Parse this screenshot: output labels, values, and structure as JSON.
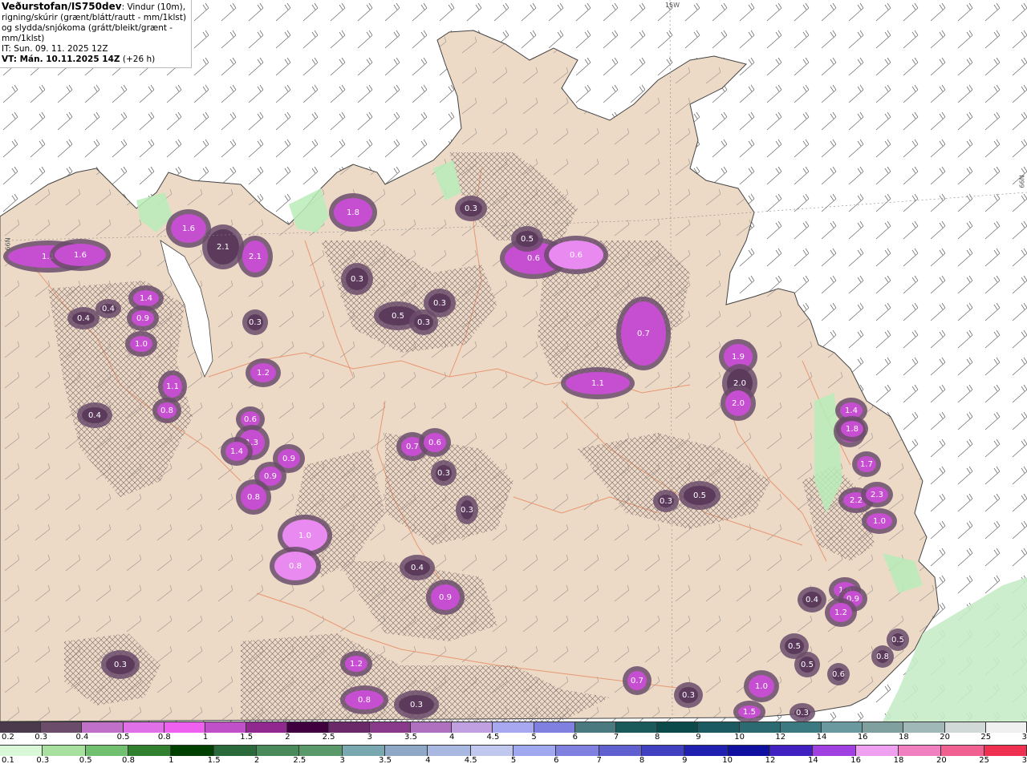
{
  "header": {
    "source": "Veðurstofan/IS750dev",
    "description": ": Vindur (10m), rigning/skúrir (grænt/blátt/rautt - mm/1klst) og slydda/snjókoma (grátt/bleikt/grænt - mm/1klst)",
    "issue_time": "IT: Sun. 09. 11. 2025 12Z",
    "valid_time": "VT: Mán. 10.11.2025 14Z",
    "lead_time": "(+26 h)"
  },
  "grid_labels": {
    "lon": "15W",
    "lat_left": "66N",
    "lat_right": "66N"
  },
  "colors": {
    "land": "#ecd9c6",
    "sea": "#ffffff",
    "road": "#e8906a",
    "snow_outline": "#5b3a5b"
  },
  "snow_cells": [
    {
      "label": "1.1",
      "shade": "mid"
    },
    {
      "label": "1.6",
      "shade": "mid"
    },
    {
      "label": "1.6",
      "shade": "mid"
    },
    {
      "label": "2.1",
      "shade": "dark"
    },
    {
      "label": "2.1",
      "shade": "mid"
    },
    {
      "label": "1.8",
      "shade": "mid"
    },
    {
      "label": "0.3",
      "shade": "dark"
    },
    {
      "label": "0.3",
      "shade": "dark"
    },
    {
      "label": "0.4",
      "shade": "dark"
    },
    {
      "label": "0.6",
      "shade": "mid"
    },
    {
      "label": "0.6",
      "shade": "light"
    },
    {
      "label": "0.5",
      "shade": "dark"
    },
    {
      "label": "0.3",
      "shade": "dark"
    },
    {
      "label": "0.3",
      "shade": "dark"
    },
    {
      "label": "0.5",
      "shade": "dark"
    },
    {
      "label": "0.7",
      "shade": "mid"
    },
    {
      "label": "1.1",
      "shade": "mid"
    },
    {
      "label": "1.9",
      "shade": "mid"
    },
    {
      "label": "2.0",
      "shade": "dark"
    },
    {
      "label": "2.0",
      "shade": "mid"
    },
    {
      "label": "1.4",
      "shade": "mid"
    },
    {
      "label": "0.9",
      "shade": "mid"
    },
    {
      "label": "1.0",
      "shade": "mid"
    },
    {
      "label": "1.1",
      "shade": "mid"
    },
    {
      "label": "0.8",
      "shade": "mid"
    },
    {
      "label": "0.4",
      "shade": "dark"
    },
    {
      "label": "0.4",
      "shade": "dark"
    },
    {
      "label": "1.2",
      "shade": "mid"
    },
    {
      "label": "0.6",
      "shade": "mid"
    },
    {
      "label": "1.3",
      "shade": "mid"
    },
    {
      "label": "1.4",
      "shade": "mid"
    },
    {
      "label": "0.9",
      "shade": "mid"
    },
    {
      "label": "0.9",
      "shade": "mid"
    },
    {
      "label": "0.8",
      "shade": "mid"
    },
    {
      "label": "1.0",
      "shade": "light"
    },
    {
      "label": "0.8",
      "shade": "light"
    },
    {
      "label": "0.7",
      "shade": "mid"
    },
    {
      "label": "0.6",
      "shade": "mid"
    },
    {
      "label": "0.3",
      "shade": "dark"
    },
    {
      "label": "0.3",
      "shade": "dark"
    },
    {
      "label": "0.4",
      "shade": "dark"
    },
    {
      "label": "0.9",
      "shade": "mid"
    },
    {
      "label": "0.3",
      "shade": "dark"
    },
    {
      "label": "1.2",
      "shade": "mid"
    },
    {
      "label": "0.8",
      "shade": "mid"
    },
    {
      "label": "0.3",
      "shade": "dark"
    },
    {
      "label": "0.7",
      "shade": "mid"
    },
    {
      "label": "0.3",
      "shade": "dark"
    },
    {
      "label": "1.0",
      "shade": "mid"
    },
    {
      "label": "1.2",
      "shade": "mid"
    },
    {
      "label": "0.3",
      "shade": "dark"
    },
    {
      "label": "0.5",
      "shade": "dark"
    },
    {
      "label": "1.4",
      "shade": "mid"
    },
    {
      "label": "1.8",
      "shade": "mid"
    },
    {
      "label": "1.7",
      "shade": "mid"
    },
    {
      "label": "2.2",
      "shade": "mid"
    },
    {
      "label": "2.3",
      "shade": "mid"
    },
    {
      "label": "1.0",
      "shade": "mid"
    },
    {
      "label": "1.0",
      "shade": "mid"
    },
    {
      "label": "0.9",
      "shade": "mid"
    },
    {
      "label": "0.4",
      "shade": "dark"
    },
    {
      "label": "1.2",
      "shade": "mid"
    },
    {
      "label": "0.5",
      "shade": "dark"
    },
    {
      "label": "0.5",
      "shade": "dark"
    },
    {
      "label": "0.8",
      "shade": "dark"
    },
    {
      "label": "0.6",
      "shade": "dark"
    },
    {
      "label": "1.5",
      "shade": "mid"
    },
    {
      "label": "0.3",
      "shade": "dark"
    },
    {
      "label": "0.5",
      "shade": "dark"
    },
    {
      "label": "0.3",
      "shade": "dark"
    }
  ],
  "legend_sleet_snow": {
    "labels": [
      "0.2",
      "0.3",
      "0.4",
      "0.5",
      "0.8",
      "1",
      "1.5",
      "2",
      "2.5",
      "3",
      "3.5",
      "4",
      "4.5",
      "5",
      "6",
      "7",
      "8",
      "9",
      "10",
      "12",
      "14",
      "16",
      "18",
      "20",
      "25",
      "30"
    ],
    "colors": [
      "#4b3a4b",
      "#6b4c6b",
      "#c070c8",
      "#e070e8",
      "#f060f0",
      "#c050c8",
      "#902890",
      "#400040",
      "#6a2a6a",
      "#8a3a8a",
      "#b070c0",
      "#c0a0e0",
      "#a8a8f0",
      "#8080e0",
      "#4a7a80",
      "#1a5a5a",
      "#0a4a4a",
      "#1a5a60",
      "#2a6a70",
      "#3a7a80",
      "#6a9aa0",
      "#80a0a0",
      "#a0b8b8",
      "#d0d8d8",
      "#f0f0f0"
    ]
  },
  "legend_rain": {
    "labels": [
      "0.1",
      "0.3",
      "0.5",
      "0.8",
      "1",
      "1.5",
      "2",
      "2.5",
      "3",
      "3.5",
      "4",
      "4.5",
      "5",
      "6",
      "7",
      "8",
      "9",
      "10",
      "12",
      "14",
      "16",
      "18",
      "20",
      "25",
      "30"
    ],
    "colors": [
      "#d8f8d8",
      "#a8e0a0",
      "#70c070",
      "#308030",
      "#004000",
      "#2a6a3a",
      "#4a8a5a",
      "#5a9a6a",
      "#7aa8b0",
      "#90a8c8",
      "#a8b8e0",
      "#c0c8f0",
      "#a0a8f0",
      "#8080e0",
      "#6060d0",
      "#4040c0",
      "#2020b0",
      "#1010a0",
      "#4020c0",
      "#a040e0",
      "#f0a0f0",
      "#f080c0",
      "#f06090",
      "#f03050"
    ]
  }
}
